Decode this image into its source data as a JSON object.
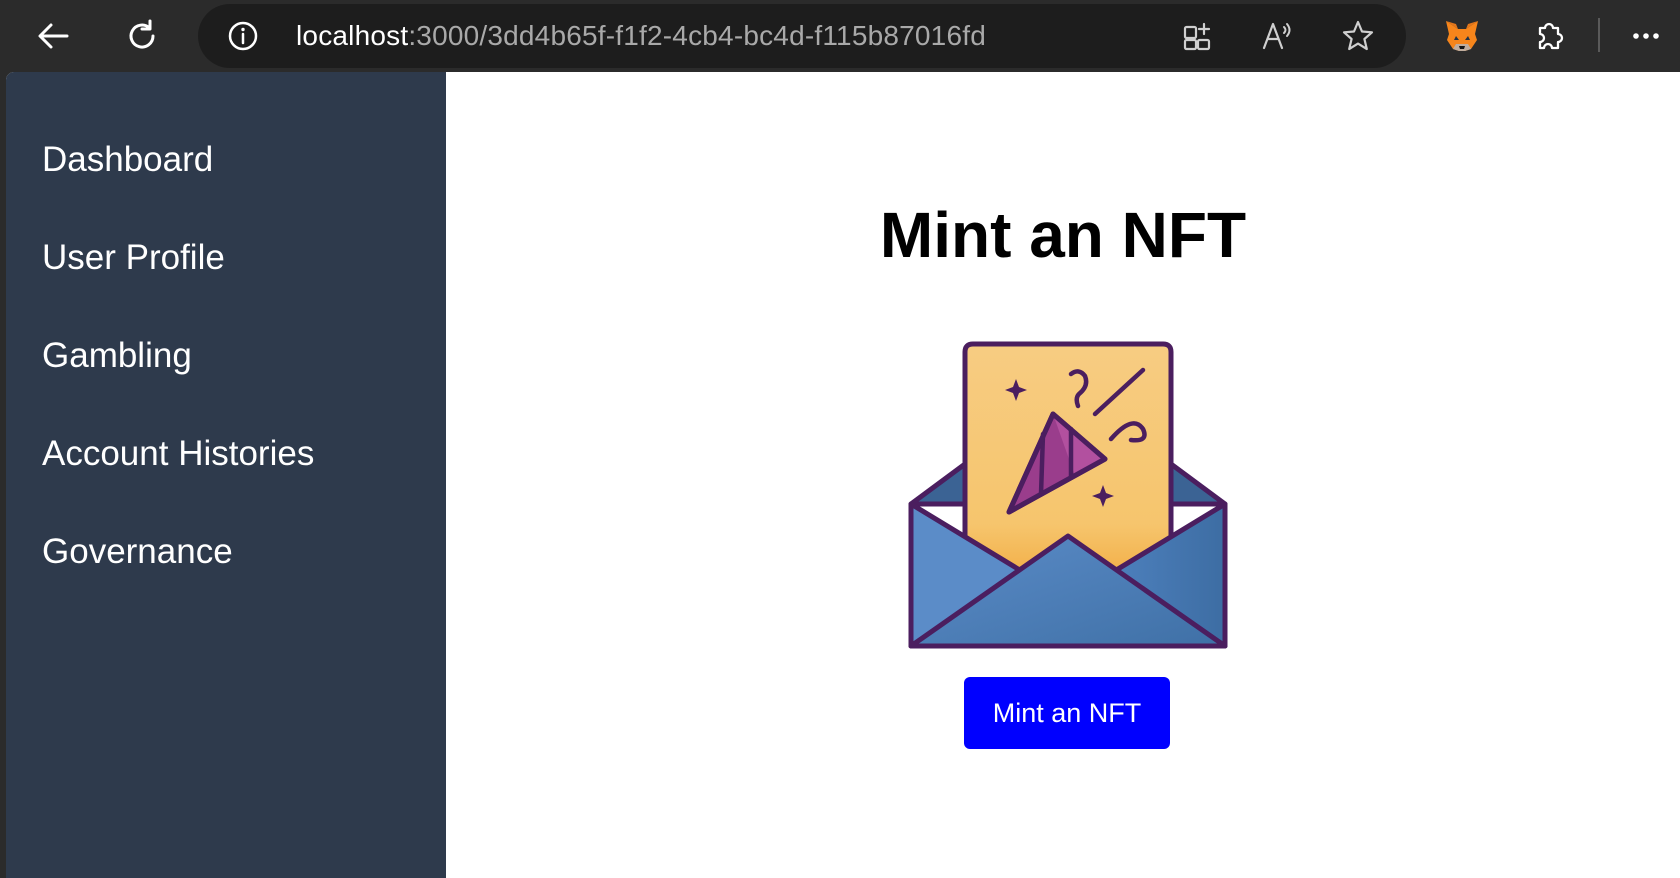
{
  "browser": {
    "url_host": "localhost",
    "url_rest": ":3000/3dd4b65f-f1f2-4cb4-bc4d-f115b87016fd",
    "icons": {
      "back": "back-arrow-icon",
      "refresh": "refresh-icon",
      "info": "info-icon",
      "split_screen": "split-screen-icon",
      "read_aloud": "read-aloud-icon",
      "favorite": "star-icon",
      "metamask": "metamask-fox-icon",
      "extensions": "extensions-puzzle-icon",
      "more": "more-dots-icon"
    }
  },
  "sidebar": {
    "items": [
      {
        "label": "Dashboard"
      },
      {
        "label": "User Profile"
      },
      {
        "label": "Gambling"
      },
      {
        "label": "Account Histories"
      },
      {
        "label": "Governance"
      }
    ]
  },
  "main": {
    "title": "Mint an NFT",
    "illustration_icon": "envelope-party-popper-icon",
    "button_label": "Mint an NFT"
  },
  "colors": {
    "sidebar_bg": "#2e3a4c",
    "button_bg": "#0000ff",
    "toolbar_bg": "#2b2b2b",
    "envelope_blue": "#4a7fb5",
    "card_yellow": "#f6c97a",
    "outline_purple": "#4b1e5f"
  }
}
